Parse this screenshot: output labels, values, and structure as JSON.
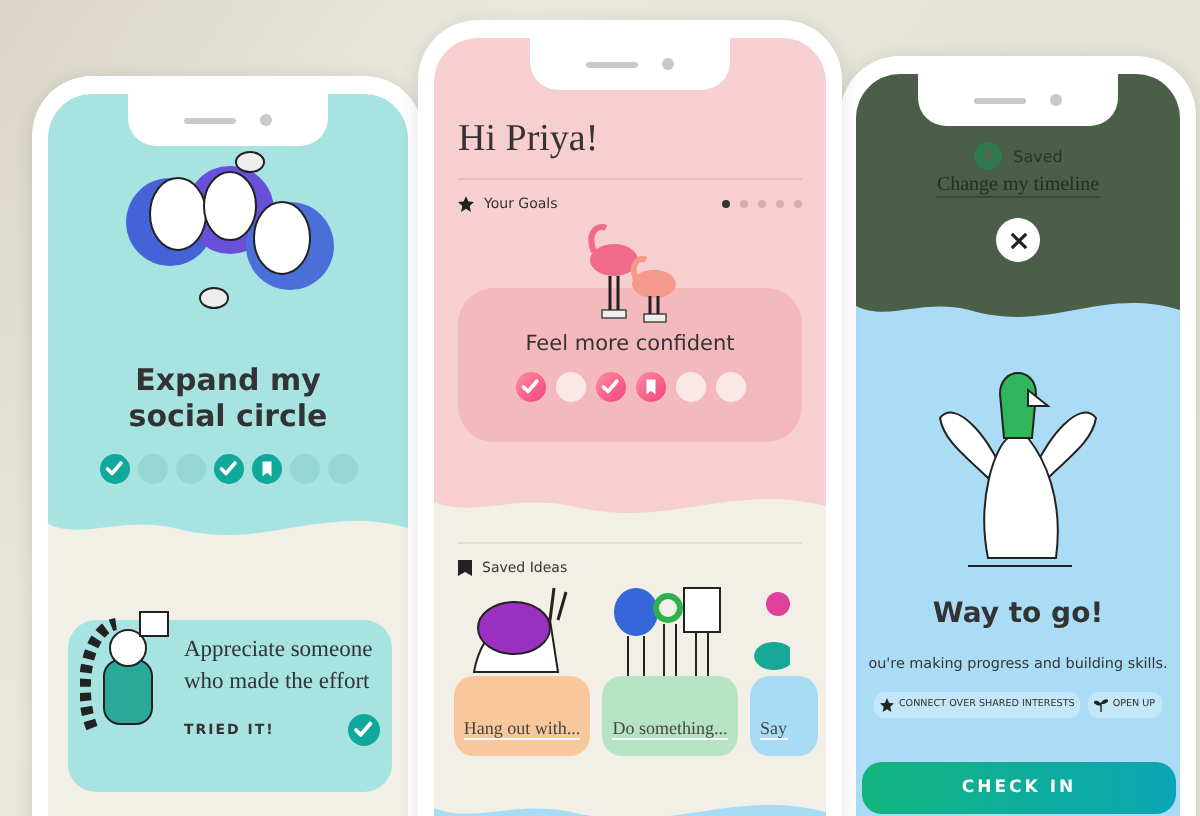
{
  "left_phone": {
    "title": "Expand my social circle",
    "steps": [
      {
        "kind": "done"
      },
      {
        "kind": "empty"
      },
      {
        "kind": "empty"
      },
      {
        "kind": "done"
      },
      {
        "kind": "saved"
      },
      {
        "kind": "empty"
      },
      {
        "kind": "empty"
      }
    ],
    "card": {
      "text": "Appreciate someone who made the effort",
      "action": "TRIED IT!",
      "checked": true
    }
  },
  "middle_phone": {
    "greeting": "Hi Priya!",
    "goals_label": "Your Goals",
    "pager_dots": [
      {
        "selected": true
      },
      {
        "selected": false
      },
      {
        "selected": false
      },
      {
        "selected": false
      },
      {
        "selected": false
      }
    ],
    "goal_title": "Feel more confident",
    "steps": [
      {
        "kind": "done"
      },
      {
        "kind": "empty"
      },
      {
        "kind": "done"
      },
      {
        "kind": "saved"
      },
      {
        "kind": "empty"
      },
      {
        "kind": "empty"
      }
    ],
    "saved_label": "Saved Ideas",
    "ideas": [
      {
        "label": "Hang out with...",
        "color": "#f8c89c"
      },
      {
        "label": "Do something...",
        "color": "#b6e4c2"
      },
      {
        "label": "Say",
        "color": "#a8dbf4"
      }
    ]
  },
  "right_phone": {
    "saved_label": "Saved",
    "link": "Change my timeline",
    "title": "Way to go!",
    "message": "ou're making progress and building skills.",
    "tags": [
      "CONNECT OVER SHARED INTERESTS",
      "OPEN UP"
    ],
    "button": "CHECK IN"
  }
}
